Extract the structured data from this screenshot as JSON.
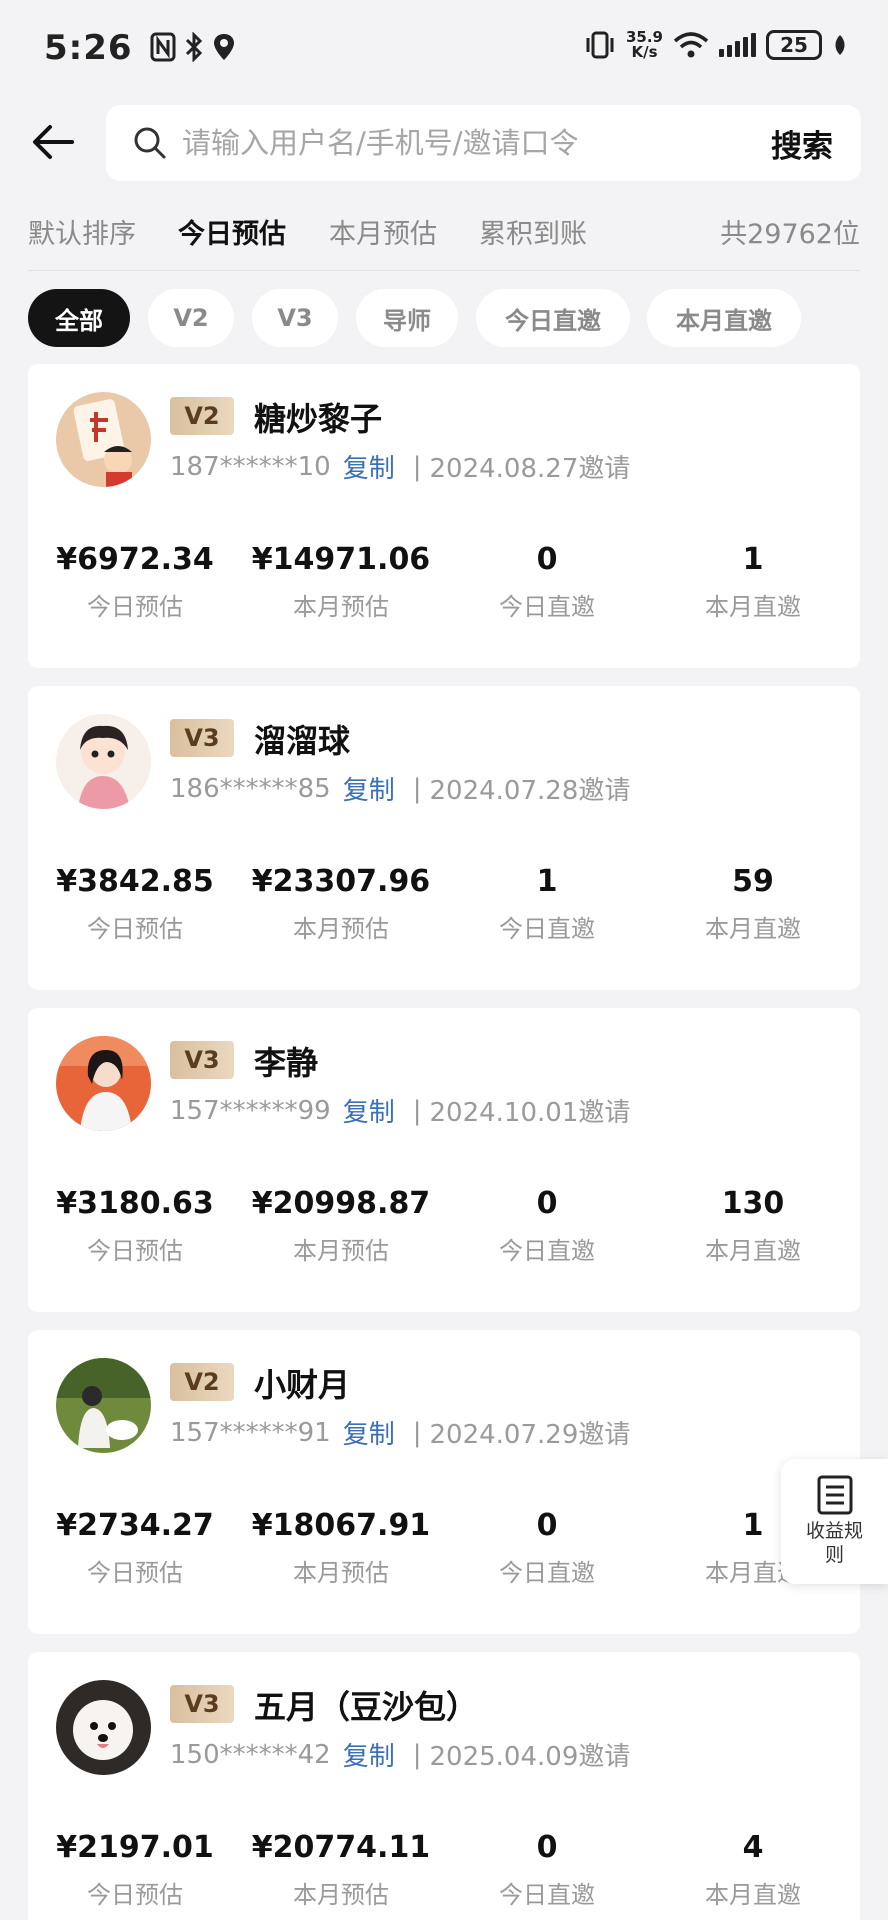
{
  "status_bar": {
    "time": "5:26",
    "net_speed_value": "35.9",
    "net_speed_unit": "K/s",
    "battery": "25"
  },
  "search": {
    "placeholder": "请输入用户名/手机号/邀请口令",
    "button_label": "搜索"
  },
  "sort_tabs": [
    "默认排序",
    "今日预估",
    "本月预估",
    "累积到账"
  ],
  "total_count": "共29762位",
  "filter_chips": [
    "全部",
    "V2",
    "V3",
    "导师",
    "今日直邀",
    "本月直邀"
  ],
  "users": [
    {
      "level": "V2",
      "name": "糖炒黎子",
      "phone": "187******10",
      "copy_label": "复制",
      "invite_date": "2024.08.27邀请",
      "stats": [
        {
          "value": "¥6972.34",
          "label": "今日预估"
        },
        {
          "value": "¥14971.06",
          "label": "本月预估"
        },
        {
          "value": "0",
          "label": "今日直邀"
        },
        {
          "value": "1",
          "label": "本月直邀"
        }
      ]
    },
    {
      "level": "V3",
      "name": "溜溜球",
      "phone": "186******85",
      "copy_label": "复制",
      "invite_date": "2024.07.28邀请",
      "stats": [
        {
          "value": "¥3842.85",
          "label": "今日预估"
        },
        {
          "value": "¥23307.96",
          "label": "本月预估"
        },
        {
          "value": "1",
          "label": "今日直邀"
        },
        {
          "value": "59",
          "label": "本月直邀"
        }
      ]
    },
    {
      "level": "V3",
      "name": "李静",
      "phone": "157******99",
      "copy_label": "复制",
      "invite_date": "2024.10.01邀请",
      "stats": [
        {
          "value": "¥3180.63",
          "label": "今日预估"
        },
        {
          "value": "¥20998.87",
          "label": "本月预估"
        },
        {
          "value": "0",
          "label": "今日直邀"
        },
        {
          "value": "130",
          "label": "本月直邀"
        }
      ]
    },
    {
      "level": "V2",
      "name": "小财月",
      "phone": "157******91",
      "copy_label": "复制",
      "invite_date": "2024.07.29邀请",
      "stats": [
        {
          "value": "¥2734.27",
          "label": "今日预估"
        },
        {
          "value": "¥18067.91",
          "label": "本月预估"
        },
        {
          "value": "0",
          "label": "今日直邀"
        },
        {
          "value": "1",
          "label": "本月直邀"
        }
      ]
    },
    {
      "level": "V3",
      "name": "五月（豆沙包）",
      "phone": "150******42",
      "copy_label": "复制",
      "invite_date": "2025.04.09邀请",
      "stats": [
        {
          "value": "¥2197.01",
          "label": "今日预估"
        },
        {
          "value": "¥20774.11",
          "label": "本月预估"
        },
        {
          "value": "0",
          "label": "今日直邀"
        },
        {
          "value": "4",
          "label": "本月直邀"
        }
      ]
    }
  ],
  "float_button": {
    "label": "收益规则",
    "icon": "document-list-icon"
  },
  "colors": {
    "background": "#f3f3f5",
    "accent_link": "#3b6fb6",
    "active_chip": "#141414",
    "level_badge": "#d9bf9d"
  }
}
